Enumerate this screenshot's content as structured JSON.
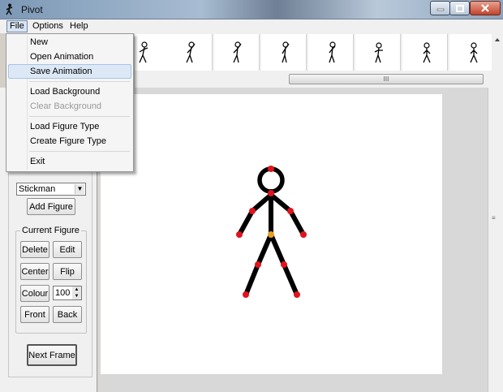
{
  "window": {
    "title": "Pivot"
  },
  "menubar": {
    "file": "File",
    "options": "Options",
    "help": "Help"
  },
  "file_menu": {
    "new": "New",
    "open_animation": "Open Animation",
    "save_animation": "Save Animation",
    "load_background": "Load Background",
    "clear_background": "Clear Background",
    "load_figure_type": "Load Figure Type",
    "create_figure_type": "Create Figure Type",
    "exit": "Exit"
  },
  "frames_scroll": {
    "grip": "III"
  },
  "figure_panel": {
    "figure_type": "Stickman",
    "add_figure": "Add Figure",
    "current_figure_label": "Current Figure",
    "delete": "Delete",
    "edit": "Edit",
    "center": "Center",
    "flip": "Flip",
    "colour": "Colour",
    "colour_value": "100",
    "front": "Front",
    "back": "Back",
    "next_frame": "Next Frame"
  },
  "colors": {
    "joint": "#e0141e",
    "center_joint": "#e8a020",
    "limb": "#000000"
  }
}
